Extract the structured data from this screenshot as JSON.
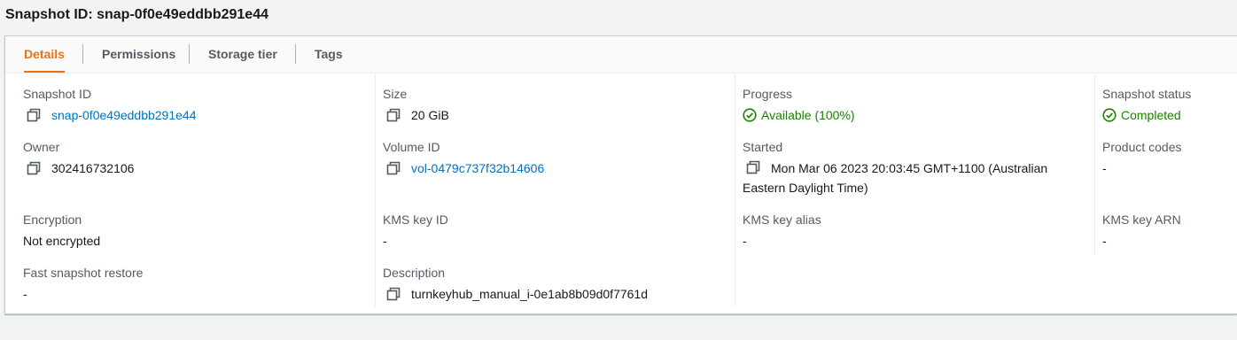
{
  "page": {
    "title": "Snapshot ID: snap-0f0e49eddbb291e44"
  },
  "tabs": [
    {
      "label": "Details",
      "active": true
    },
    {
      "label": "Permissions",
      "active": false
    },
    {
      "label": "Storage tier",
      "active": false
    },
    {
      "label": "Tags",
      "active": false
    }
  ],
  "details": {
    "snapshot_id": {
      "label": "Snapshot ID",
      "value": "snap-0f0e49eddbb291e44"
    },
    "size": {
      "label": "Size",
      "value": "20 GiB"
    },
    "progress": {
      "label": "Progress",
      "value": "Available (100%)"
    },
    "snapshot_status": {
      "label": "Snapshot status",
      "value": "Completed"
    },
    "owner": {
      "label": "Owner",
      "value": "302416732106"
    },
    "volume_id": {
      "label": "Volume ID",
      "value": "vol-0479c737f32b14606"
    },
    "started": {
      "label": "Started",
      "value": "Mon Mar 06 2023 20:03:45 GMT+1100 (Australian Eastern Daylight Time)"
    },
    "product_codes": {
      "label": "Product codes",
      "value": "-"
    },
    "encryption": {
      "label": "Encryption",
      "value": "Not encrypted"
    },
    "kms_key_id": {
      "label": "KMS key ID",
      "value": "-"
    },
    "kms_key_alias": {
      "label": "KMS key alias",
      "value": "-"
    },
    "kms_key_arn": {
      "label": "KMS key ARN",
      "value": "-"
    },
    "fast_snapshot_restore": {
      "label": "Fast snapshot restore",
      "value": "-"
    },
    "description": {
      "label": "Description",
      "value": "turnkeyhub_manual_i-0e1ab8b09d0f7761d"
    }
  },
  "colors": {
    "accent": "#ec7211",
    "link": "#0073bb",
    "success": "#1d8102",
    "label": "#545b64"
  },
  "icons": {
    "copy": "copy-icon",
    "status_ok": "check-circle-icon"
  }
}
